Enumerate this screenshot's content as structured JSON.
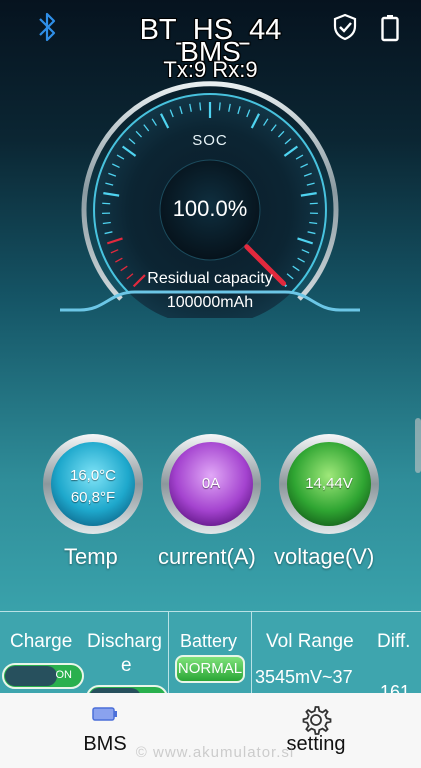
{
  "header": {
    "device_name": "BT_HS_44",
    "device_sub": "BMS",
    "txrx": "Tx:9 Rx:9"
  },
  "gauge": {
    "label": "SOC",
    "value": "100.0%",
    "soc_percent": 100,
    "residual_label": "Residual capacity",
    "residual_value": "100000mAh"
  },
  "metrics": [
    {
      "line1": "16,0°C",
      "line2": "60,8°F",
      "label": "Temp",
      "color": "#2bb7d8"
    },
    {
      "line1": "0A",
      "label": "current(A)",
      "color": "#a443cf"
    },
    {
      "line1": "14,44V",
      "label": "voltage(V)",
      "color": "#2fa532"
    }
  ],
  "info": {
    "charge_label": "Charge",
    "charge_toggle": "ON",
    "discharge_label_1": "Discharg",
    "discharge_label_2": "e",
    "battery_label": "Battery",
    "battery_status": "NORMAL",
    "vol_range_label": "Vol Range",
    "vol_range_value": "3545mV~37",
    "diff_label": "Diff.",
    "diff_value": "161"
  },
  "nav": {
    "bms_label": "BMS",
    "setting_label": "setting"
  },
  "watermark": "© www.akumulator.si",
  "colors": {
    "accent_cyan": "#4fd3f0",
    "gauge_red": "#e2293d",
    "toggle_green": "#2ab04e"
  }
}
